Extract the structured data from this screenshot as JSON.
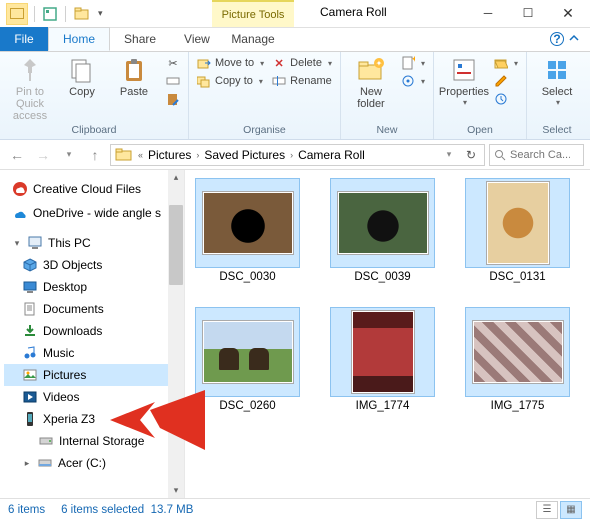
{
  "window": {
    "title": "Camera Roll",
    "contextual_tab_group": "Picture Tools"
  },
  "tabs": {
    "file": "File",
    "home": "Home",
    "share": "Share",
    "view": "View",
    "manage": "Manage"
  },
  "ribbon": {
    "clipboard": {
      "label": "Clipboard",
      "pin": "Pin to Quick access",
      "copy": "Copy",
      "paste": "Paste"
    },
    "organise": {
      "label": "Organise",
      "move_to": "Move to",
      "copy_to": "Copy to",
      "delete": "Delete",
      "rename": "Rename"
    },
    "new": {
      "label": "New",
      "new_folder": "New folder"
    },
    "open": {
      "label": "Open",
      "properties": "Properties"
    },
    "select": {
      "label": "Select",
      "select_btn": "Select"
    }
  },
  "breadcrumb": {
    "items": [
      "Pictures",
      "Saved Pictures",
      "Camera Roll"
    ]
  },
  "search": {
    "placeholder": "Search Ca..."
  },
  "tree": {
    "creative_cloud": "Creative Cloud Files",
    "onedrive": "OneDrive - wide angle s",
    "this_pc": "This PC",
    "objects3d": "3D Objects",
    "desktop": "Desktop",
    "documents": "Documents",
    "downloads": "Downloads",
    "music": "Music",
    "pictures": "Pictures",
    "videos": "Videos",
    "xperia": "Xperia Z3",
    "internal_storage": "Internal Storage",
    "acer": "Acer (C:)"
  },
  "items": [
    {
      "name": "DSC_0030",
      "orient": "land",
      "style": "ph-dog-dark"
    },
    {
      "name": "DSC_0039",
      "orient": "land",
      "style": "ph-dog-black"
    },
    {
      "name": "DSC_0131",
      "orient": "port",
      "style": "ph-dog-tan"
    },
    {
      "name": "DSC_0260",
      "orient": "land",
      "style": "ph-horses"
    },
    {
      "name": "IMG_1774",
      "orient": "port",
      "style": "ph-handstand"
    },
    {
      "name": "IMG_1775",
      "orient": "land",
      "style": "ph-misc"
    }
  ],
  "status": {
    "count": "6 items",
    "selected": "6 items selected",
    "size": "13.7 MB"
  }
}
